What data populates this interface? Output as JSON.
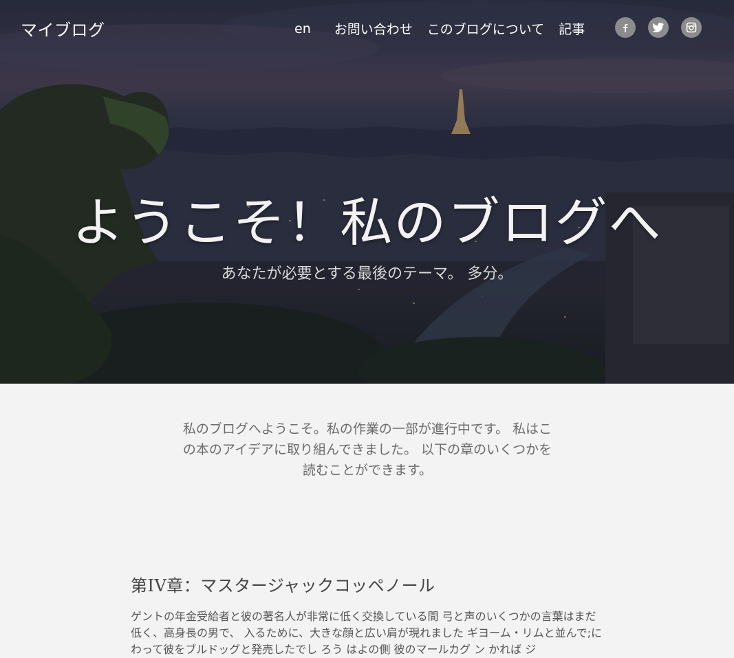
{
  "header": {
    "brand": "マイブログ",
    "nav": [
      {
        "label": "en"
      },
      {
        "label": "お問い合わせ"
      },
      {
        "label": "このブログについて"
      },
      {
        "label": "記事"
      }
    ],
    "social": [
      {
        "icon": "facebook-icon"
      },
      {
        "icon": "twitter-icon"
      },
      {
        "icon": "instagram-icon"
      }
    ]
  },
  "hero": {
    "title": "ようこそ！私のブログへ",
    "subtitle": "あなたが必要とする最後のテーマ。 多分。"
  },
  "intro": {
    "text": "私のブログへようこそ。私の作業の一部が進行中です。 私はこの本のアイデアに取り組んできました。 以下の章のいくつかを読むことができます。"
  },
  "post": {
    "title": "第IV章：マスタージャックコッペノール",
    "excerpt": "ゲントの年金受給者と彼の著名人が非常に低く交換している間 弓と声のいくつかの言葉はまだ低く、高身長の男で、 入るために、大きな顔と広い肩が現れました ギヨーム・リムと並んで;にわって彼をブルドッグと発売したでし ろう はよの側 彼のマールカグ ン かれば ジ"
  },
  "colors": {
    "page_bg": "#f3f3f3",
    "social_bg": "#8c8c8c",
    "hero_text": "#f2f2f2"
  }
}
